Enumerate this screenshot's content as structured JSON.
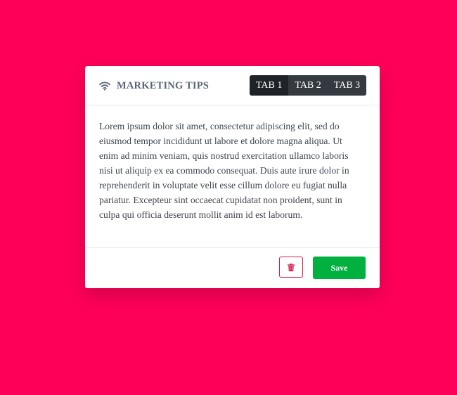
{
  "colors": {
    "page_background": "#ff0059",
    "card_background": "#ffffff",
    "title_color": "#5a6478",
    "tab_background": "#353a40",
    "tab_active_background": "#1f2327",
    "delete_accent": "#d21a4a",
    "save_background": "#00b140"
  },
  "card": {
    "title_icon": "wifi-icon",
    "title": "MARKETING TIPS",
    "tabs": [
      {
        "label": "TAB 1",
        "active": true
      },
      {
        "label": "TAB 2",
        "active": false
      },
      {
        "label": "TAB 3",
        "active": false
      }
    ],
    "body_text": "Lorem ipsum dolor sit amet, consectetur adipiscing elit, sed do eiusmod tempor incididunt ut labore et dolore magna aliqua. Ut enim ad minim veniam, quis nostrud exercitation ullamco laboris nisi ut aliquip ex ea commodo consequat. Duis aute irure dolor in reprehenderit in voluptate velit esse cillum dolore eu fugiat nulla pariatur. Excepteur sint occaecat cupidatat non proident, sunt in culpa qui officia deserunt mollit anim id est laborum.",
    "footer": {
      "delete_icon": "trash-icon",
      "save_label": "Save"
    }
  }
}
